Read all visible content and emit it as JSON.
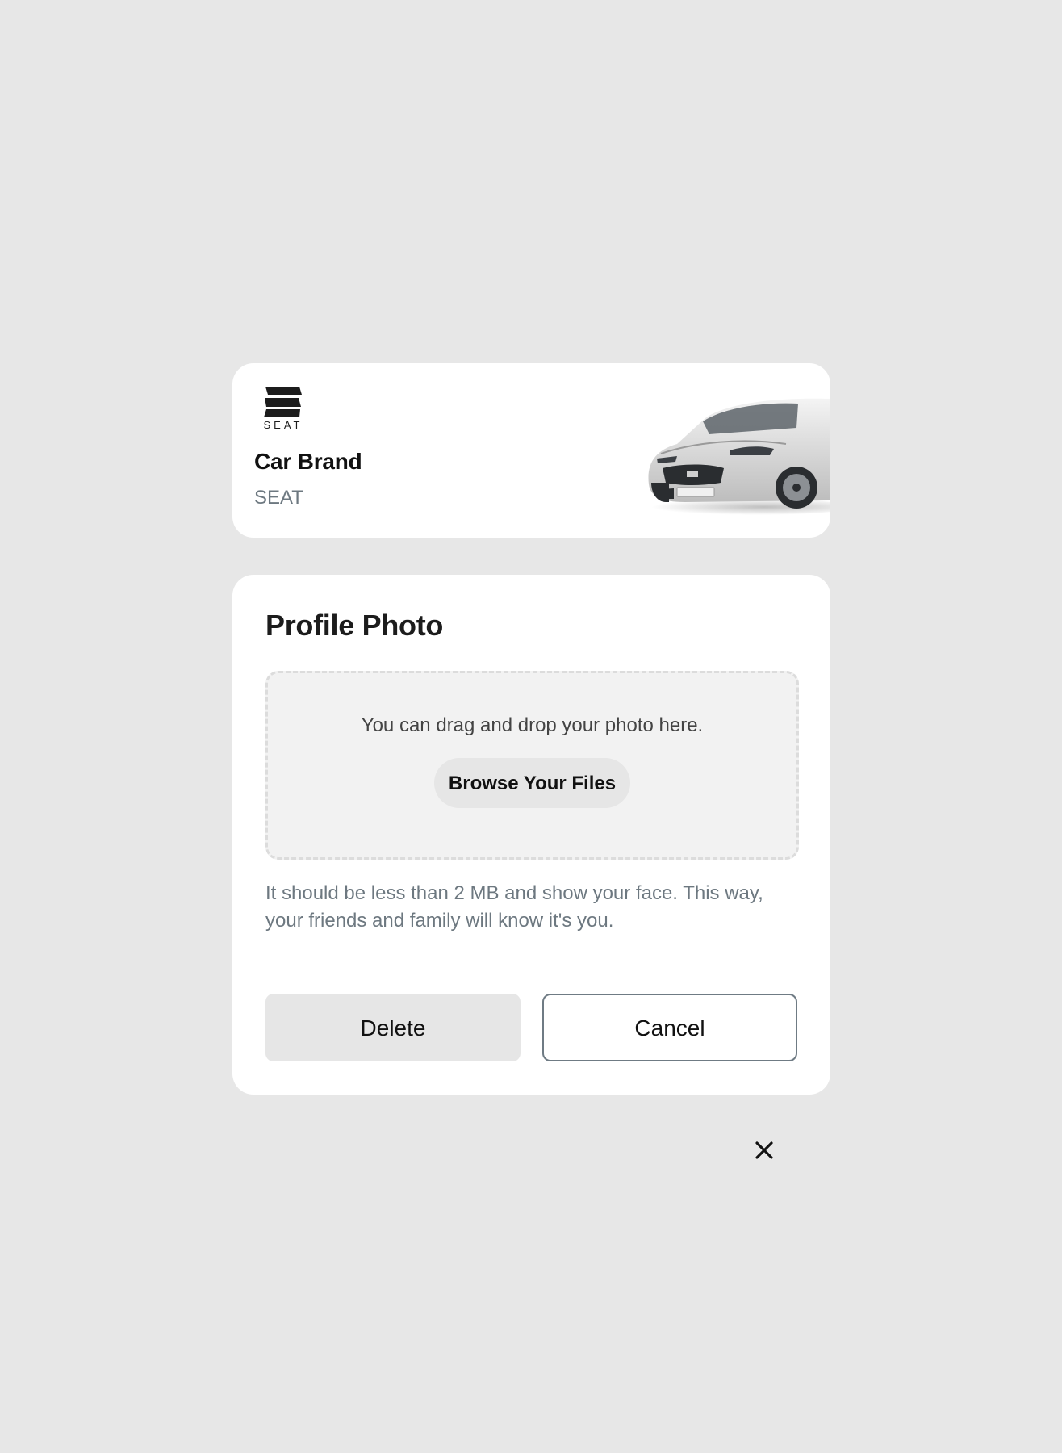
{
  "brand": {
    "logo_icon": "seat-logo-icon",
    "logo_wordmark": "SEAT",
    "label": "Car Brand",
    "value": "SEAT",
    "image": "car-image"
  },
  "profile_photo": {
    "title": "Profile Photo",
    "dropzone_text": "You can drag and drop your photo here.",
    "browse_label": "Browse Your Files",
    "hint": "It should be less than 2 MB and show your face. This way, your friends and family will know it's you.",
    "delete_label": "Delete",
    "cancel_label": "Cancel"
  },
  "close": {
    "icon": "close-icon"
  },
  "colors": {
    "background": "#e7e7e7",
    "card": "#ffffff",
    "muted_text": "#6d7880",
    "button_gray": "#e6e6e6",
    "outline": "#6f7b84"
  }
}
